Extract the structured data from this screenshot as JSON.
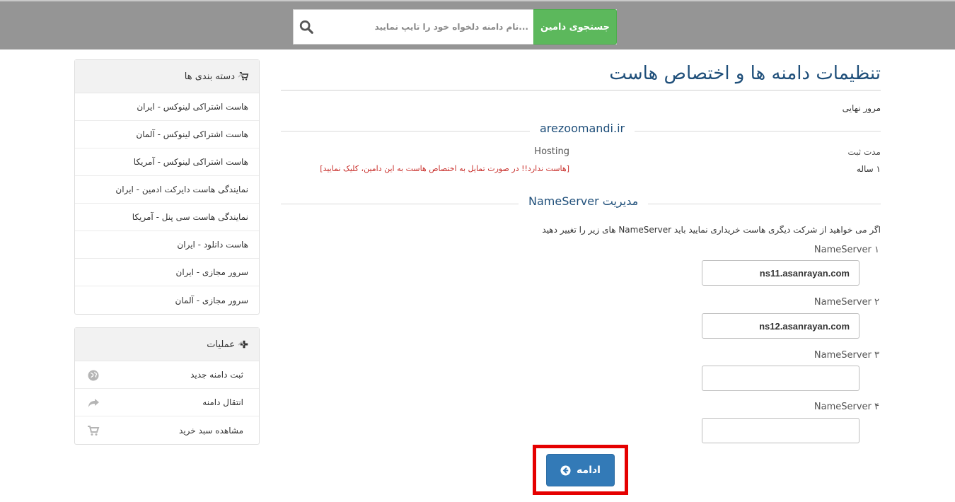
{
  "search": {
    "placeholder": "...نام دامنه دلخواه خود را تایپ نمایید",
    "button_label": "جستجوی دامین"
  },
  "sidebar": {
    "categories": {
      "title": "دسته بندی ها",
      "items": [
        "هاست اشتراکی لینوکس - ایران",
        "هاست اشتراکی لینوکس - آلمان",
        "هاست اشتراکی لینوکس - آمریکا",
        "نمایندگی هاست دایرکت ادمین - ایران",
        "نمایندگی هاست سی پنل - آمریکا",
        "هاست دانلود - ایران",
        "سرور مجازی - ایران",
        "سرور مجازی - آلمان"
      ]
    },
    "operations": {
      "title": "عملیات",
      "items": [
        {
          "label": "ثبت دامنه جدید",
          "icon": "globe-icon"
        },
        {
          "label": "انتقال دامنه",
          "icon": "share-arrow-icon"
        },
        {
          "label": "مشاهده سبد خرید",
          "icon": "cart-icon"
        }
      ]
    }
  },
  "main": {
    "title": "تنظیمات دامنه ها و اختصاص هاست",
    "review_label": "مرور نهایی",
    "domain": "arezoomandi.ir",
    "period_label": "مدت ثبت",
    "period_value": "۱ ساله",
    "hosting_label": "Hosting",
    "hosting_value": "[هاست ندارد!! در صورت تمایل به اختصاص هاست به این دامین، کلیک نمایید]",
    "ns_section_title": "مدیریت NameServer",
    "ns_note": "اگر می خواهید از شرکت دیگری هاست خریداری نمایید باید NameServer های زیر را تغییر دهید",
    "nameservers": [
      {
        "label": "NameServer ۱",
        "value": "ns11.asanrayan.com"
      },
      {
        "label": "NameServer ۲",
        "value": "ns12.asanrayan.com"
      },
      {
        "label": "NameServer ۳",
        "value": ""
      },
      {
        "label": "NameServer ۴",
        "value": ""
      }
    ],
    "continue_label": "ادامه"
  },
  "colors": {
    "topbar": "#959595",
    "search_button": "#5cb85c",
    "title": "#1f4f7a",
    "hosting_warning": "#c9302c",
    "primary_button": "#337ab7",
    "highlight_frame": "#e50000"
  }
}
